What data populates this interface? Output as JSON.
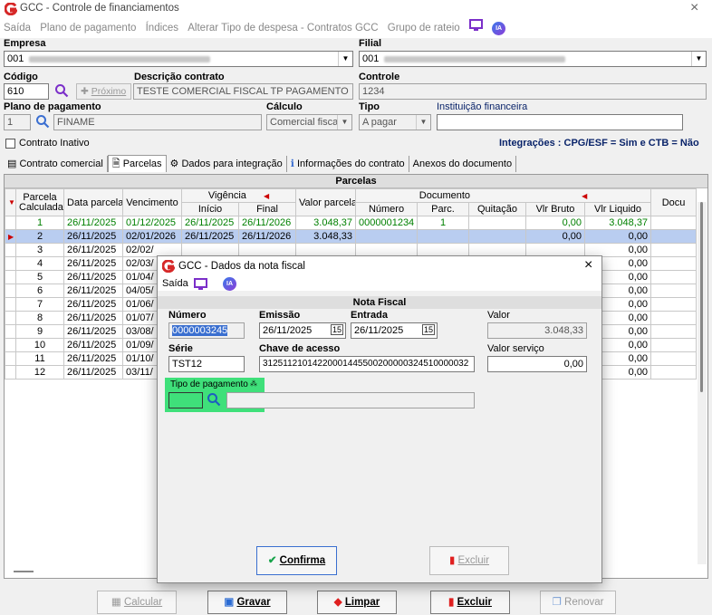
{
  "window": {
    "title": "GCC - Controle de financiamentos",
    "close": "×"
  },
  "menu": [
    "Saída",
    "Plano de pagamento",
    "Índices",
    "Alterar Tipo de despesa - Contratos GCC",
    "Grupo de rateio"
  ],
  "ia_label": "IA",
  "empresa": {
    "label": "Empresa",
    "value": "001"
  },
  "filial": {
    "label": "Filial",
    "value": "001"
  },
  "codigo": {
    "label": "Código",
    "value": "610",
    "proximo": "Próximo"
  },
  "descricao": {
    "label": "Descrição contrato",
    "value": "TESTE COMERCIAL FISCAL TP PAGAMENTO"
  },
  "controle": {
    "label": "Controle",
    "value": "1234"
  },
  "plano": {
    "label": "Plano de pagamento",
    "code": "1",
    "value": "FINAME"
  },
  "calculo": {
    "label": "Cálculo",
    "value": "Comercial fiscal"
  },
  "tipo": {
    "label": "Tipo",
    "value": "A pagar"
  },
  "instituicao": {
    "label": "Instituição financeira",
    "value": ""
  },
  "inativo": {
    "label": "Contrato Inativo"
  },
  "integracoes": "Integrações : CPG/ESF = Sim e CTB = Não",
  "tabs": [
    "Contrato comercial",
    "Parcelas",
    "Dados para integração",
    "Informações do contrato",
    "Anexos do documento"
  ],
  "grid": {
    "title": "Parcelas",
    "headers": {
      "parcela": "Parcela Calculada",
      "data": "Data parcela",
      "venc": "Vencimento",
      "vigencia": "Vigência",
      "inicio": "Início",
      "final": "Final",
      "valor": "Valor parcela",
      "documento": "Documento",
      "numero": "Número",
      "parc": "Parc.",
      "quitacao": "Quitação",
      "bruto": "Vlr Bruto",
      "liquido": "Vlr Liquido",
      "docu": "Docu"
    },
    "rows": [
      {
        "n": "1",
        "data": "26/11/2025",
        "venc": "01/12/2025",
        "ini": "26/11/2025",
        "fim": "26/11/2026",
        "valor": "3.048,37",
        "num": "0000001234",
        "parc": "1",
        "bruto": "0,00",
        "liq": "3.048,37"
      },
      {
        "n": "2",
        "data": "26/11/2025",
        "venc": "02/01/2026",
        "ini": "26/11/2025",
        "fim": "26/11/2026",
        "valor": "3.048,33",
        "num": "",
        "parc": "",
        "bruto": "0,00",
        "liq": "0,00"
      },
      {
        "n": "3",
        "data": "26/11/2025",
        "venc": "02/02/",
        "liq": "0,00"
      },
      {
        "n": "4",
        "data": "26/11/2025",
        "venc": "02/03/",
        "liq": "0,00"
      },
      {
        "n": "5",
        "data": "26/11/2025",
        "venc": "01/04/",
        "liq": "0,00"
      },
      {
        "n": "6",
        "data": "26/11/2025",
        "venc": "04/05/",
        "liq": "0,00"
      },
      {
        "n": "7",
        "data": "26/11/2025",
        "venc": "01/06/",
        "liq": "0,00"
      },
      {
        "n": "8",
        "data": "26/11/2025",
        "venc": "01/07/",
        "liq": "0,00"
      },
      {
        "n": "9",
        "data": "26/11/2025",
        "venc": "03/08/",
        "liq": "0,00"
      },
      {
        "n": "10",
        "data": "26/11/2025",
        "venc": "01/09/",
        "liq": "0,00"
      },
      {
        "n": "11",
        "data": "26/11/2025",
        "venc": "01/10/",
        "liq": "0,00"
      },
      {
        "n": "12",
        "data": "26/11/2025",
        "venc": "03/11/",
        "liq": "0,00"
      }
    ]
  },
  "buttons": {
    "calcular": "Calcular",
    "gravar": "Gravar",
    "limpar": "Limpar",
    "excluir": "Excluir",
    "renovar": "Renovar"
  },
  "dialog": {
    "title": "GCC - Dados da nota fiscal",
    "close": "×",
    "menu_saida": "Saída",
    "section": "Nota Fiscal",
    "numero": {
      "label": "Número",
      "value": "0000003245"
    },
    "emissao": {
      "label": "Emissão",
      "value": "26/11/2025"
    },
    "entrada": {
      "label": "Entrada",
      "value": "26/11/2025"
    },
    "valor": {
      "label": "Valor",
      "value": "3.048,33"
    },
    "serie": {
      "label": "Série",
      "value": "TST12"
    },
    "chave": {
      "label": "Chave de acesso",
      "value": "31251121014220001445500200000324510000032"
    },
    "valor_servico": {
      "label": "Valor serviço",
      "value": "0,00"
    },
    "tipo_pagamento": {
      "label": "Tipo de pagamento"
    },
    "confirma": "Confirma",
    "excluir": "Excluir"
  },
  "colors": {
    "accent": "#0a246a",
    "highlight": "#3fe07a",
    "selected_row": "#b9cdf0"
  }
}
